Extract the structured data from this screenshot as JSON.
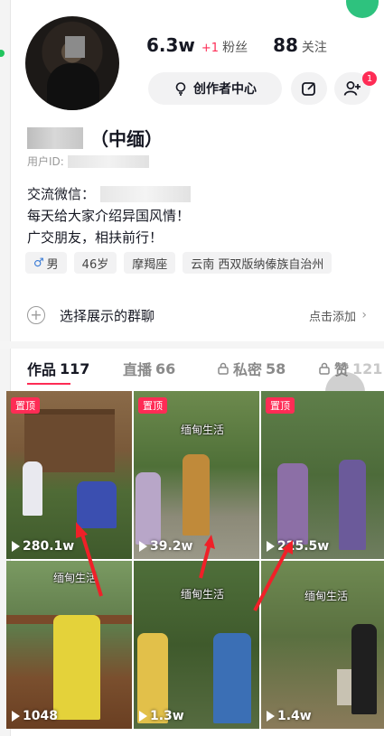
{
  "profile": {
    "followers_count": "6.3w",
    "followers_delta": "+1",
    "followers_label": "粉丝",
    "following_count": "88",
    "following_label": "关注",
    "name_suffix": "（中缅）",
    "uid_label": "用户ID:",
    "bio": [
      "交流微信：",
      "每天给大家介绍异国风情！",
      "广交朋友，相扶前行！"
    ],
    "tags": [
      {
        "icon": "male-icon",
        "label": "男"
      },
      {
        "label": "46岁"
      },
      {
        "label": "摩羯座"
      },
      {
        "label": "云南 西双版纳傣族自治州"
      }
    ],
    "notification_count": "1"
  },
  "actions": {
    "creator_center": "创作者中心"
  },
  "group": {
    "label": "选择展示的群聊",
    "action": "点击添加"
  },
  "tabs": [
    {
      "label": "作品",
      "count": "117"
    },
    {
      "label": "直播",
      "count": "66"
    },
    {
      "label": "私密",
      "count": "58"
    },
    {
      "label": "赞",
      "count": "121"
    }
  ],
  "videos": [
    {
      "pinned": "置顶",
      "plays": "280.1w",
      "caption": ""
    },
    {
      "pinned": "置顶",
      "plays": "39.2w",
      "caption": "缅甸生活"
    },
    {
      "pinned": "置顶",
      "plays": "225.5w",
      "caption": ""
    },
    {
      "pinned": "",
      "plays": "1048",
      "caption": "缅甸生活"
    },
    {
      "pinned": "",
      "plays": "1.3w",
      "caption": "缅甸生活"
    },
    {
      "pinned": "",
      "plays": "1.4w",
      "caption": "缅甸生活"
    }
  ],
  "colors": {
    "accent": "#fe2c55",
    "text": "#161823",
    "secondary": "#8a8a8a"
  }
}
